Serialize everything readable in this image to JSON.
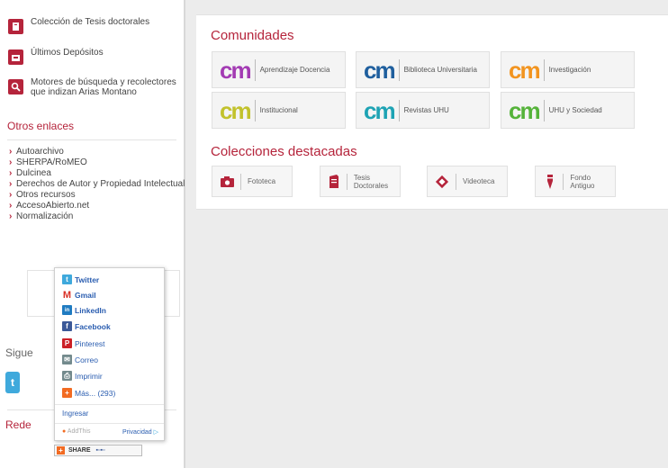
{
  "sidebar": {
    "links": [
      {
        "label": "Colección de Tesis doctorales",
        "icon": "book-icon"
      },
      {
        "label": "Últimos Depósitos",
        "icon": "inbox-icon"
      },
      {
        "label": "Motores de búsqueda y recolectores que indizan Arias Montano",
        "icon": "search-icon"
      }
    ],
    "other_title": "Otros enlaces",
    "other_links": [
      "Autoarchivo",
      "SHERPA/RoMEO",
      "Dulcinea",
      "Derechos de Autor y Propiedad Intelectual",
      "Otros recursos",
      "AccesoAbierto.net",
      "Normalización"
    ],
    "sigue_label": "Sigue",
    "redes_label": "Rede"
  },
  "share_popup": {
    "items": [
      {
        "label": "Twitter",
        "icon": "twitter-icon",
        "color": "#3fa9dc",
        "glyph": "t"
      },
      {
        "label": "Gmail",
        "icon": "gmail-icon",
        "color": "#ffffff",
        "glyph": "M"
      },
      {
        "label": "LinkedIn",
        "icon": "linkedin-icon",
        "color": "#1f7bc1",
        "glyph": "in"
      },
      {
        "label": "Facebook",
        "icon": "facebook-icon",
        "color": "#3b5998",
        "glyph": "f"
      },
      {
        "label": "Pinterest",
        "icon": "pinterest-icon",
        "color": "#cb2027",
        "glyph": "P"
      },
      {
        "label": "Correo",
        "icon": "mail-icon",
        "color": "#738a8d",
        "glyph": "✉"
      },
      {
        "label": "Imprimir",
        "icon": "print-icon",
        "color": "#738a8d",
        "glyph": "⎙"
      },
      {
        "label": "Más... (293)",
        "icon": "more-icon",
        "color": "#f26b22",
        "glyph": "+"
      }
    ],
    "signin": "Ingresar",
    "addthis": "AddThis",
    "privacy": "Privacidad",
    "share_button": "SHARE"
  },
  "main": {
    "comunidades_title": "Comunidades",
    "communities": [
      {
        "label": "Aprendizaje Docencia",
        "color": "#a33bb3"
      },
      {
        "label": "Biblioteca Universitaria",
        "color": "#1f5f9e"
      },
      {
        "label": "Investigación",
        "color": "#f2941f"
      },
      {
        "label": "Institucional",
        "color": "#c2c22c"
      },
      {
        "label": "Revistas UHU",
        "color": "#1ea3b4"
      },
      {
        "label": "UHU y Sociedad",
        "color": "#55b33a"
      }
    ],
    "logo_text": "cm",
    "colecciones_title": "Colecciones destacadas",
    "collections": [
      {
        "label": "Fototeca",
        "icon": "camera-icon"
      },
      {
        "label": "Tesis Doctorales",
        "icon": "book-icon"
      },
      {
        "label": "Videoteca",
        "icon": "tag-icon"
      },
      {
        "label": "Fondo Antiguo",
        "icon": "pen-nib-icon"
      }
    ]
  },
  "colors": {
    "accent": "#b5243b"
  }
}
